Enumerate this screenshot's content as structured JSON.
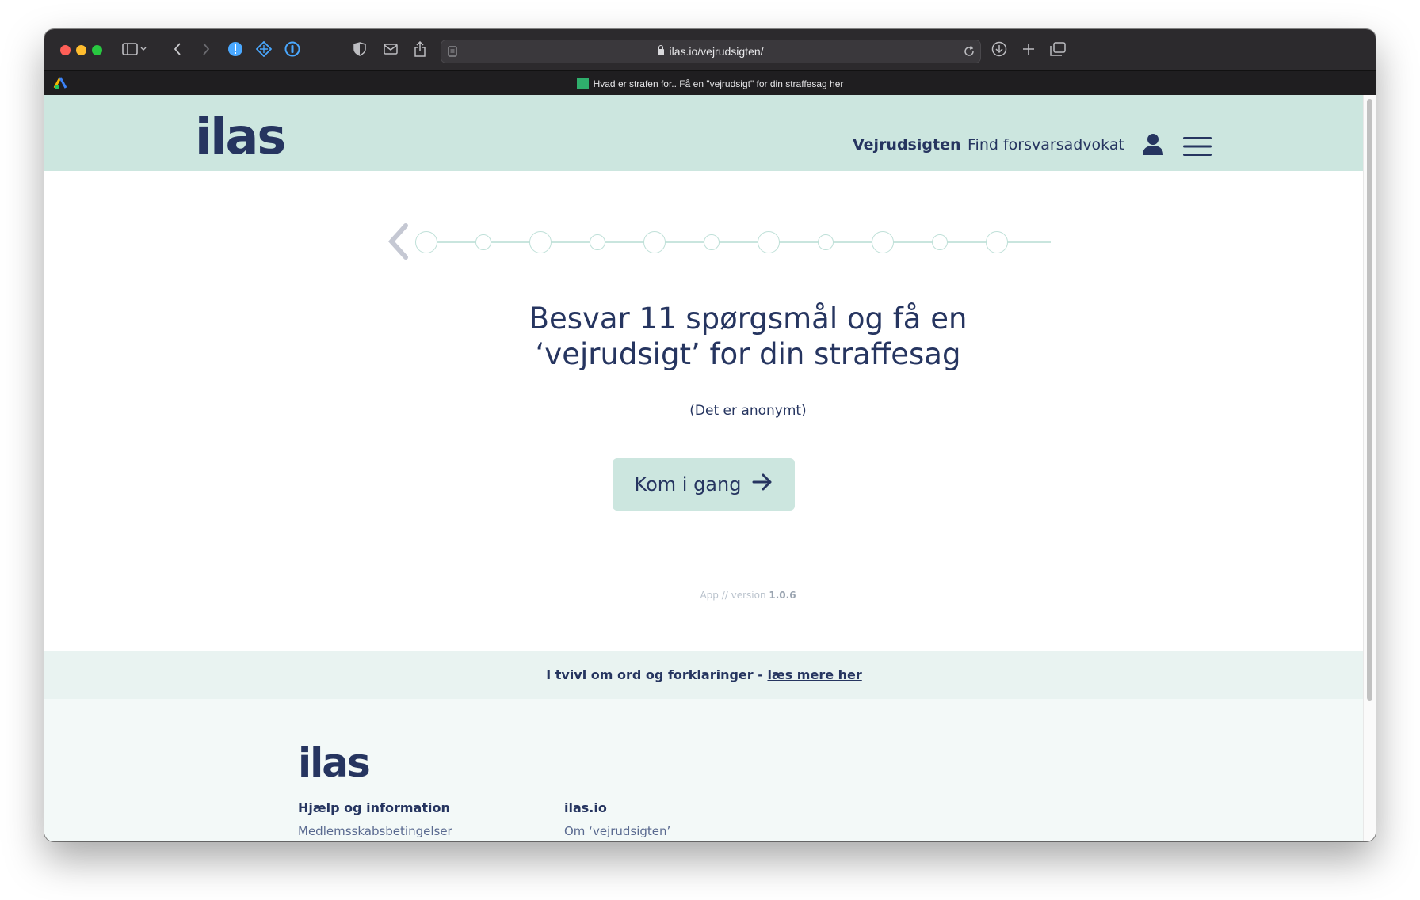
{
  "browser": {
    "url": "ilas.io/vejrudsigten/",
    "tab_title": "Hvad er strafen for.. Få en \"vejrudsigt\" for din straffesag her"
  },
  "site": {
    "logo": "ilas",
    "nav": {
      "active": "Vejrudsigten",
      "link": "Find forsvarsadvokat"
    }
  },
  "main": {
    "heading_line1": "Besvar 11 spørgsmål og få en",
    "heading_line2": "‘vejrudsigt’ for din straffesag",
    "subtext": "(Det er anonymt)",
    "cta_label": "Kom i gang",
    "version_prefix": "App // version",
    "version_number": "1.0.6",
    "steps": 11
  },
  "help_bar": {
    "text": "I tvivl om ord og forklaringer - ",
    "link": "læs mere her"
  },
  "footer": {
    "logo": "ilas",
    "col1_title": "Hjælp og information",
    "col1_link": "Medlemsskabsbetingelser",
    "col2_title": "ilas.io",
    "col2_link": "Om ‘vejrudsigten’"
  },
  "colors": {
    "brand_navy": "#263560",
    "brand_mint": "#cce6df"
  }
}
